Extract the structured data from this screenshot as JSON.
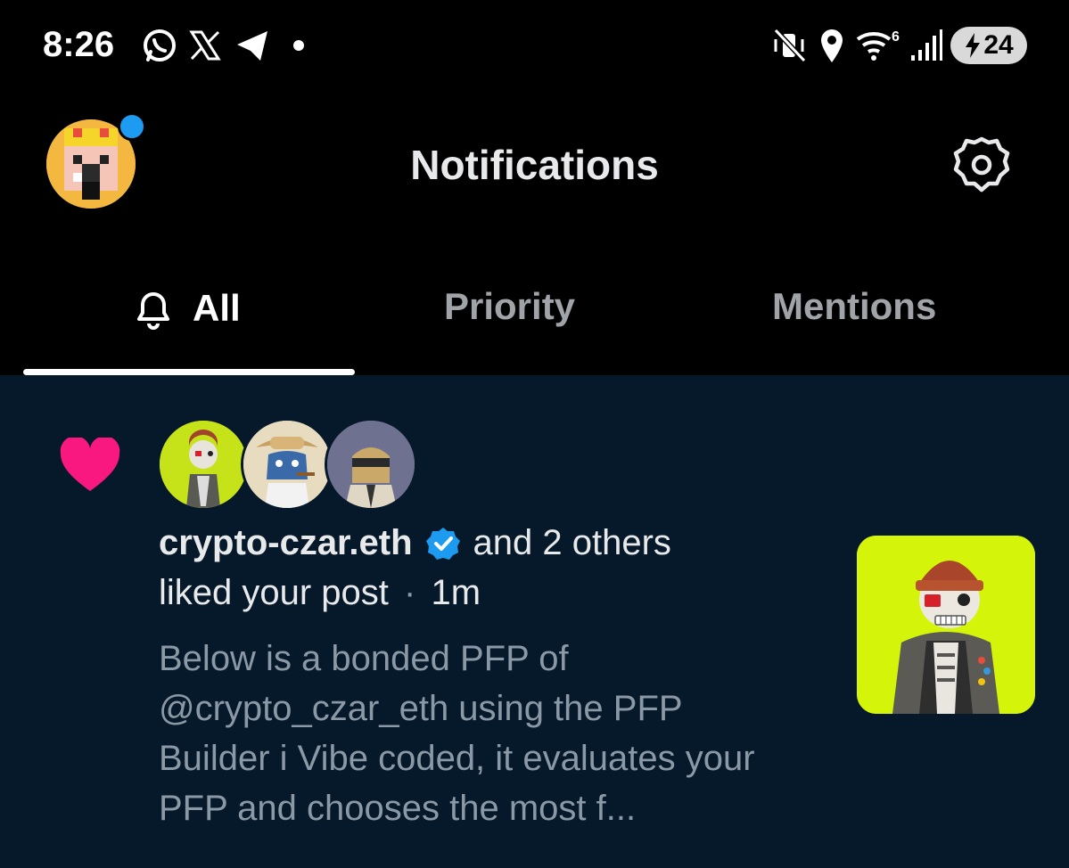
{
  "status_bar": {
    "time": "8:26",
    "app_icons": [
      "whatsapp-icon",
      "x-icon",
      "telegram-icon",
      "dot-icon"
    ],
    "system_icons": [
      "vibrate-off-icon",
      "location-icon",
      "wifi-6-icon",
      "signal-icon"
    ],
    "battery_level": "24",
    "battery_charging": true
  },
  "header": {
    "title": "Notifications",
    "has_new_dot": true,
    "accent_color": "#1d9bf0"
  },
  "tabs": [
    {
      "label": "All",
      "active": true,
      "icon": "bell-icon"
    },
    {
      "label": "Priority",
      "active": false
    },
    {
      "label": "Mentions",
      "active": false
    }
  ],
  "notification": {
    "type_icon": "heart-icon",
    "type_color": "#f91880",
    "username": "crypto-czar.eth",
    "verified": true,
    "others_text": "and 2 others",
    "action_text": "liked your post",
    "separator": "·",
    "time": "1m",
    "preview": "Below is a bonded PFP of @crypto_czar_eth using the PFP Builder i Vibe coded, it evaluates your PFP and chooses the most f..."
  }
}
